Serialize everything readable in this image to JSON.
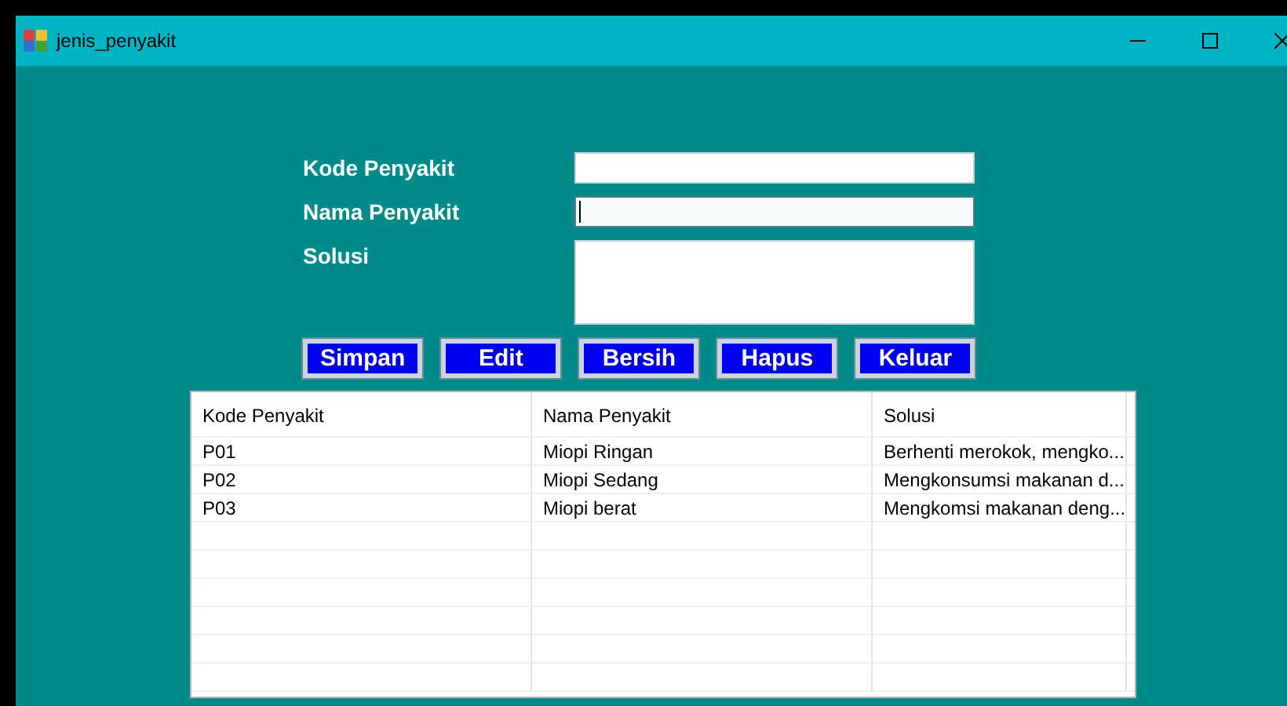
{
  "window": {
    "title": "jenis_penyakit"
  },
  "form": {
    "fields": [
      {
        "label": "Kode Penyakit",
        "kind": "line",
        "focused": false
      },
      {
        "label": "Nama Penyakit",
        "kind": "line",
        "focused": true
      },
      {
        "label": "Solusi",
        "kind": "multiline",
        "focused": false
      }
    ]
  },
  "buttons": [
    "Simpan",
    "Edit",
    "Bersih",
    "Hapus",
    "Keluar"
  ],
  "table": {
    "columns": [
      "Kode Penyakit",
      "Nama Penyakit",
      "Solusi"
    ],
    "rows": [
      [
        "P01",
        "Miopi Ringan",
        "Berhenti merokok, mengko..."
      ],
      [
        "P02",
        "Miopi Sedang",
        "Mengkonsumsi makanan d..."
      ],
      [
        "P03",
        "Miopi berat",
        "Mengkomsi makanan deng..."
      ]
    ]
  }
}
